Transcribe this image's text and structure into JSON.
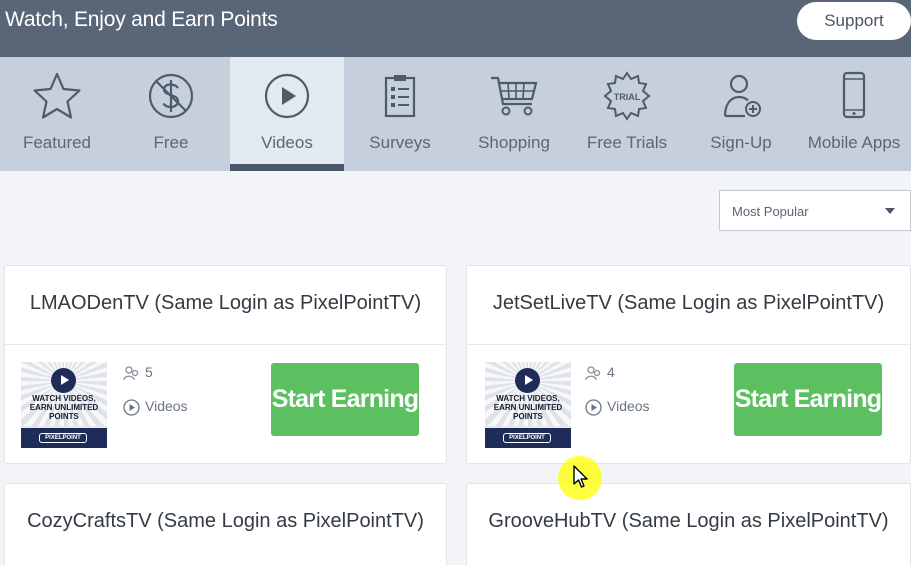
{
  "header": {
    "title": "Watch, Enjoy and Earn Points",
    "support_label": "Support"
  },
  "categories": [
    {
      "label": "Featured",
      "icon": "star-icon"
    },
    {
      "label": "Free",
      "icon": "no-dollar-icon"
    },
    {
      "label": "Videos",
      "icon": "play-circle-icon",
      "active": true
    },
    {
      "label": "Surveys",
      "icon": "clipboard-icon"
    },
    {
      "label": "Shopping",
      "icon": "cart-icon"
    },
    {
      "label": "Free Trials",
      "icon": "trial-badge-icon",
      "badge_text": "TRIAL"
    },
    {
      "label": "Sign-Up",
      "icon": "user-add-icon"
    },
    {
      "label": "Mobile Apps",
      "icon": "mobile-phone-icon"
    }
  ],
  "sort": {
    "selected": "Most Popular"
  },
  "thumbnail": {
    "text": "WATCH VIDEOS, EARN UNLIMITED POINTS",
    "brand": "PIXELPOINT"
  },
  "offers": [
    {
      "title": "LMAODenTV (Same Login as PixelPointTV)",
      "count": "5",
      "unit": "Videos",
      "cta": "Start Earning"
    },
    {
      "title": "JetSetLiveTV (Same Login as PixelPointTV)",
      "count": "4",
      "unit": "Videos",
      "cta": "Start Earning"
    },
    {
      "title": "CozyCraftsTV (Same Login as PixelPointTV)"
    },
    {
      "title": "GrooveHubTV (Same Login as PixelPointTV)"
    }
  ],
  "colors": {
    "header_bg": "#596678",
    "nav_bg": "#c6d0dd",
    "nav_active_bg": "#e3e9f1",
    "cta_green": "#5cbf60",
    "thumb_navy": "#1f2c59"
  }
}
